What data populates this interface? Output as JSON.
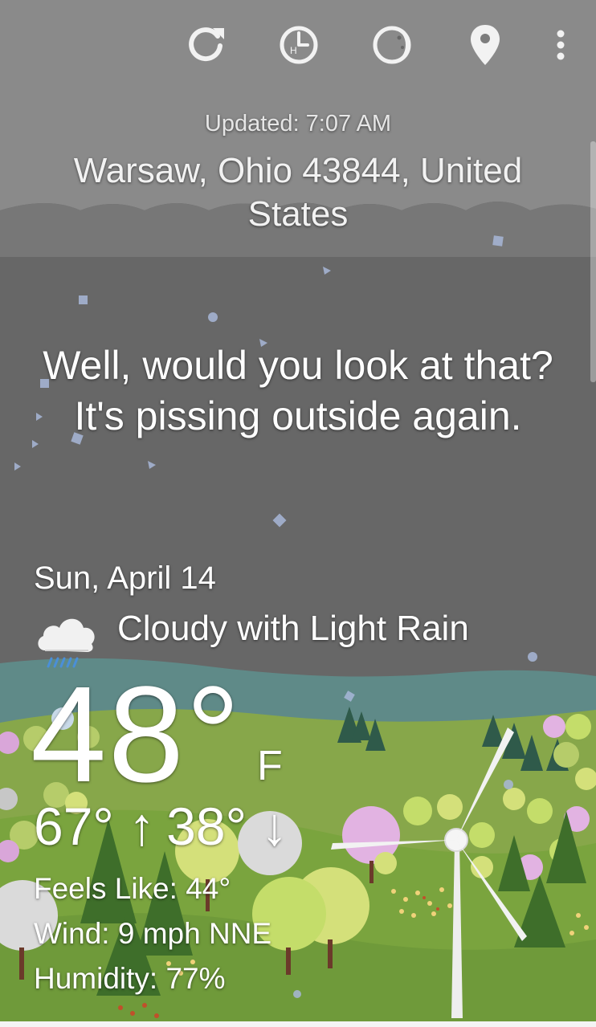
{
  "toolbar": {
    "icons": [
      "refresh-icon",
      "hourly-icon",
      "moon-phase-icon",
      "location-pin-icon",
      "more-vert-icon"
    ]
  },
  "header": {
    "updated": "Updated: 7:07 AM",
    "location": "Warsaw, Ohio 43844, United States"
  },
  "quip": "Well, would you look at that? It's pissing outside again.",
  "forecast": {
    "date": "Sun, April 14",
    "condition": "Cloudy with Light Rain",
    "condition_icon": "cloud-rain-icon",
    "temperature": "48°",
    "unit": "F",
    "high": "67° ↑",
    "low": "38° ↓",
    "feels_like": "Feels Like: 44°",
    "wind": "Wind: 9 mph NNE",
    "humidity": "Humidity: 77%"
  },
  "colors": {
    "sky": "#676767",
    "distant_hills": "#5f8a88",
    "meadow": "#87a74a",
    "foreground": "#6f9a3a"
  }
}
